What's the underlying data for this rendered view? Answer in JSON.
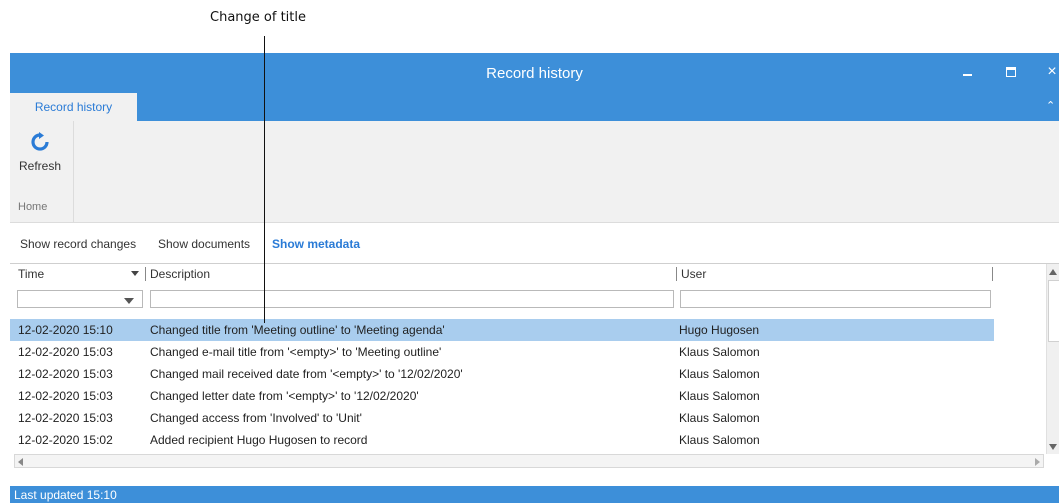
{
  "annotation": {
    "text": "Change of title"
  },
  "window": {
    "title": "Record history",
    "minimize_icon": "minimize-icon",
    "maximize_icon": "maximize-icon",
    "close_icon": "close-icon",
    "close_glyph": "×"
  },
  "ribbon": {
    "tab_label": "Record history",
    "refresh_label": "Refresh",
    "group_label": "Home",
    "collapse_glyph": "⌃"
  },
  "links": {
    "record_changes": "Show record changes",
    "documents": "Show documents",
    "metadata": "Show metadata"
  },
  "grid": {
    "columns": [
      "Time",
      "Description",
      "User"
    ],
    "rows": [
      {
        "time": "12-02-2020 15:10",
        "description": "Changed title from 'Meeting outline' to 'Meeting agenda'",
        "user": "Hugo Hugosen",
        "selected": true
      },
      {
        "time": "12-02-2020 15:03",
        "description": "Changed e-mail title from '<empty>' to 'Meeting outline'",
        "user": "Klaus Salomon",
        "selected": false
      },
      {
        "time": "12-02-2020 15:03",
        "description": "Changed mail received date from '<empty>' to '12/02/2020'",
        "user": "Klaus Salomon",
        "selected": false
      },
      {
        "time": "12-02-2020 15:03",
        "description": "Changed letter date from '<empty>' to '12/02/2020'",
        "user": "Klaus Salomon",
        "selected": false
      },
      {
        "time": "12-02-2020 15:03",
        "description": "Changed access from 'Involved' to 'Unit'",
        "user": "Klaus Salomon",
        "selected": false
      },
      {
        "time": "12-02-2020 15:02",
        "description": "Added recipient Hugo Hugosen to record",
        "user": "Klaus Salomon",
        "selected": false
      }
    ],
    "filters": {
      "time": "",
      "description": "",
      "user": ""
    }
  },
  "status": {
    "text": "Last updated 15:10"
  },
  "colors": {
    "accent": "#3d8fd9",
    "selection": "#a9cdee",
    "link_active": "#2a7bd6"
  }
}
